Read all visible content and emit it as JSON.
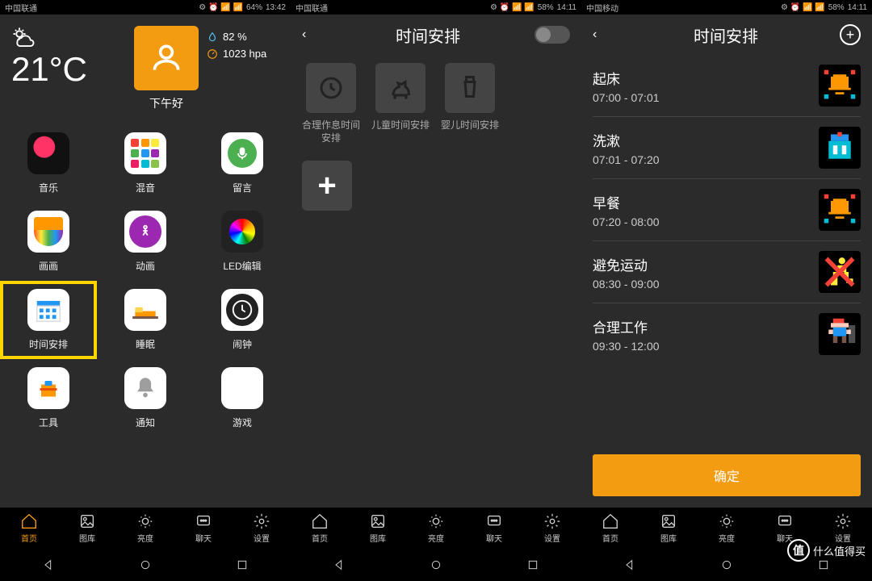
{
  "status_left": {
    "carrier1": "中国联通",
    "carrier2": "中国移动"
  },
  "status_right1": {
    "icons": "⚙ ⏰ 📶 📶",
    "batt": "64%",
    "time": "13:42"
  },
  "status_right2": {
    "icons": "⚙ ⏰ 📶 📶",
    "batt": "58%",
    "time": "14:11"
  },
  "weather": {
    "temp": "21°C",
    "humidity": "82 %",
    "pressure": "1023 hpa",
    "greeting": "下午好"
  },
  "apps": [
    {
      "label": "音乐",
      "icon": "music"
    },
    {
      "label": "混音",
      "icon": "mix"
    },
    {
      "label": "留言",
      "icon": "msg"
    },
    {
      "label": "画画",
      "icon": "paint"
    },
    {
      "label": "动画",
      "icon": "anim"
    },
    {
      "label": "LED编辑",
      "icon": "led"
    },
    {
      "label": "时间安排",
      "icon": "cal",
      "hl": true
    },
    {
      "label": "睡眠",
      "icon": "sleep"
    },
    {
      "label": "闹钟",
      "icon": "clock"
    },
    {
      "label": "工具",
      "icon": "tool"
    },
    {
      "label": "通知",
      "icon": "bell"
    },
    {
      "label": "游戏",
      "icon": "game"
    }
  ],
  "tabs": [
    {
      "label": "首页"
    },
    {
      "label": "图库"
    },
    {
      "label": "亮度"
    },
    {
      "label": "聊天"
    },
    {
      "label": "设置"
    }
  ],
  "schedule_title": "时间安排",
  "templates": [
    {
      "label": "合理作息时间安排",
      "icon": "clock"
    },
    {
      "label": "儿童时间安排",
      "icon": "horse"
    },
    {
      "label": "婴儿时间安排",
      "icon": "bottle"
    }
  ],
  "items": [
    {
      "title": "起床",
      "time": "07:00 - 07:01",
      "px": "bell-orange"
    },
    {
      "title": "洗漱",
      "time": "07:01 - 07:20",
      "px": "wash"
    },
    {
      "title": "早餐",
      "time": "07:20 - 08:00",
      "px": "bell-orange"
    },
    {
      "title": "避免运动",
      "time": "08:30 - 09:00",
      "px": "no-run"
    },
    {
      "title": "合理工作",
      "time": "09:30 - 12:00",
      "px": "mario"
    }
  ],
  "confirm": "确定",
  "watermark": "什么值得买"
}
